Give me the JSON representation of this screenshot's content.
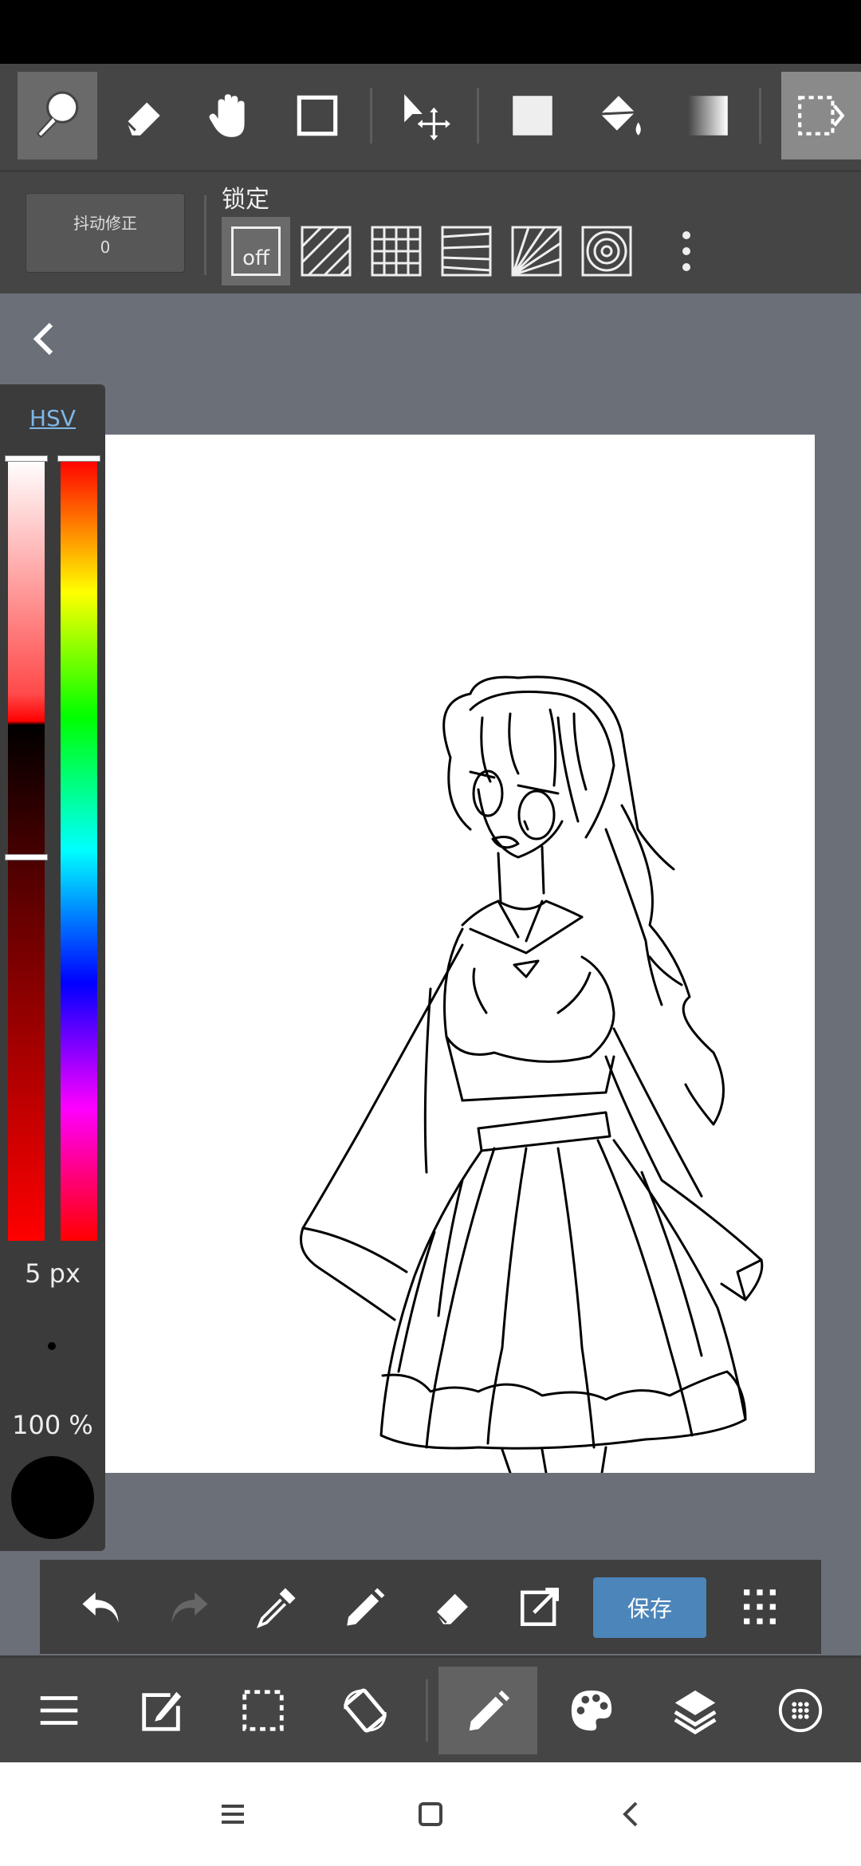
{
  "stabilizer": {
    "label": "抖动修正",
    "value": "0"
  },
  "lock": {
    "label": "锁定",
    "off_label": "off"
  },
  "color_panel": {
    "mode_link": "HSV",
    "brush_size": "5 px",
    "opacity": "100 %"
  },
  "action_bar": {
    "save_label": "保存"
  },
  "colors": {
    "toolbar_bg": "#454545",
    "canvas_bg": "#6b6f78",
    "accent_blue": "#4b85ba",
    "hsv_link": "#7fb6e6",
    "current_color": "#000000"
  }
}
